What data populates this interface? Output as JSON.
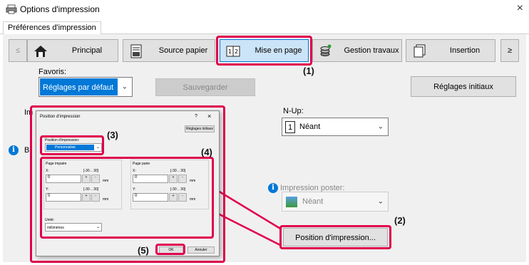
{
  "window": {
    "title": "Options d'impression",
    "close": "×"
  },
  "tabs": {
    "preferences": "Préférences d'impression"
  },
  "toolbar": {
    "prev": "≤",
    "next": "≥",
    "buttons": [
      {
        "label": "Principal",
        "icon": "home-icon"
      },
      {
        "label": "Source papier",
        "icon": "paper-source-icon"
      },
      {
        "label": "Mise en page",
        "icon": "layout-icon"
      },
      {
        "label": "Gestion travaux",
        "icon": "job-management-icon"
      },
      {
        "label": "Insertion",
        "icon": "insertion-icon"
      }
    ]
  },
  "favorites": {
    "label": "Favoris:",
    "value": "Réglages par défaut",
    "save": "Sauvegarder",
    "defaults": "Réglages initiaux"
  },
  "left_partial": {
    "b_label": "B",
    "im_label": "Im"
  },
  "nup": {
    "label": "N-Up:",
    "value": "Néant",
    "value_icon": "1"
  },
  "poster": {
    "label": "Impression poster:",
    "value": "Néant"
  },
  "position_button": "Position d'impression...",
  "callouts": {
    "c1": "(1)",
    "c2": "(2)",
    "c3": "(3)",
    "c4": "(4)",
    "c5": "(5)"
  },
  "dialog": {
    "title": "Position d'impression",
    "help": "?",
    "close": "×",
    "reset": "Réglages initiaux",
    "position_label": "Position d'impression:",
    "position_value": "Personnalisé",
    "odd": {
      "title": "Page impaire",
      "x_label": "X:",
      "x_range": "[-30 .. 30]",
      "x_value": "0",
      "y_label": "Y:",
      "y_range": "[-30 .. 30]",
      "y_value": "0"
    },
    "even": {
      "title": "Page paire",
      "x_label": "X:",
      "x_range": "[-30 .. 30]",
      "x_value": "0",
      "y_label": "Y:",
      "y_range": "[-30 .. 30]",
      "y_value": "0"
    },
    "unit_mm": "mm",
    "plus": "+",
    "minus": "-",
    "unit_label": "Unité:",
    "unit_value": "millimètres",
    "ok": "OK",
    "cancel": "Annuler"
  },
  "colors": {
    "accent": "#0078d7",
    "callout": "#e0004d"
  }
}
